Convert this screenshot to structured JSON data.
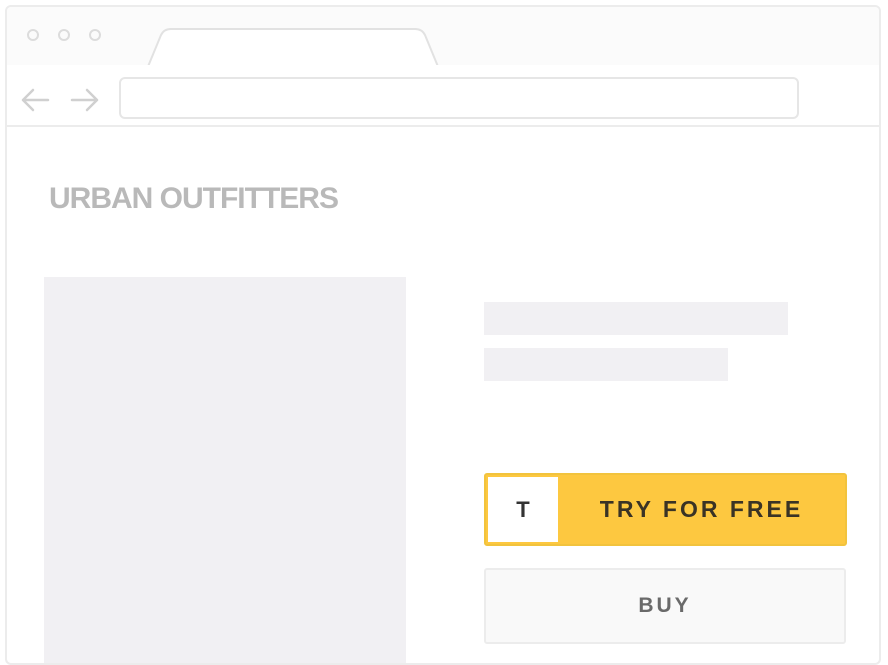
{
  "browser": {
    "window_controls": [
      "close-dot",
      "minimize-dot",
      "maximize-dot"
    ],
    "tab_label": "",
    "address": {
      "value": "",
      "placeholder": ""
    },
    "nav_icons": [
      "arrow-left-icon",
      "arrow-right-icon"
    ]
  },
  "page": {
    "brand": "URBAN OUTFITTERS",
    "try_button": {
      "logo_letter": "T",
      "label": "TRY FOR FREE"
    },
    "buy_button": {
      "label": "BUY"
    }
  },
  "colors": {
    "accent_yellow": "#fdc840",
    "placeholder_gray": "#f1f0f3",
    "brand_gray": "#b9b9b9"
  }
}
